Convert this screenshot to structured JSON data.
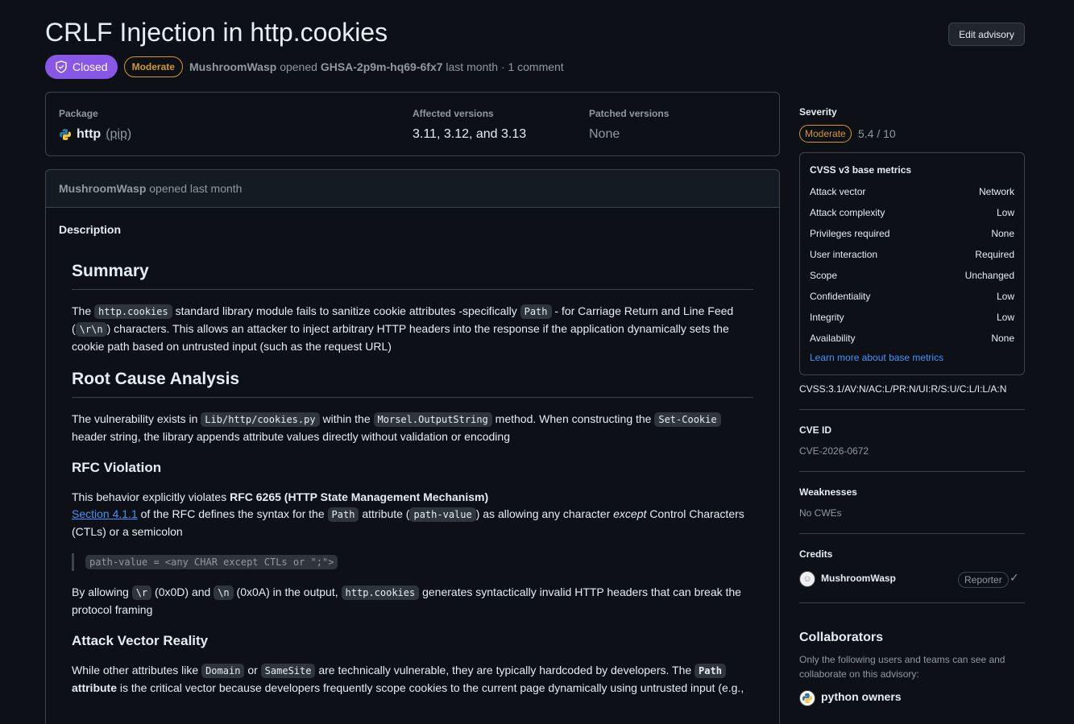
{
  "header": {
    "title": "CRLF Injection in http.cookies",
    "edit_label": "Edit advisory",
    "state": "Closed",
    "severity": "Moderate",
    "author": "MushroomWasp",
    "opened": "opened",
    "ghsa": "GHSA-2p9m-hq69-6fx7",
    "when": "last month",
    "comments": "· 1 comment"
  },
  "package": {
    "label": "Package",
    "name": "http",
    "ecosystem": "(pip)",
    "affected_label": "Affected versions",
    "affected": "3.11, 3.12, and 3.13",
    "patched_label": "Patched versions",
    "patched": "None"
  },
  "description": {
    "author": "MushroomWasp",
    "opened": "opened last month",
    "label": "Description",
    "summary_h": "Summary",
    "s1_a": "The ",
    "s1_code1": "http.cookies",
    "s1_b": " standard library module fails to sanitize cookie attributes -specifically ",
    "s1_code2": "Path",
    "s1_c": " - for Carriage Return and Line Feed (",
    "s1_code3": "\\r\\n",
    "s1_d": ") characters. This allows an attacker to inject arbitrary HTTP headers into the response if the application dynamically sets the cookie path based on untrusted input (such as the request URL)",
    "rca_h": "Root Cause Analysis",
    "r1_a": "The vulnerability exists in ",
    "r1_code1": "Lib/http/cookies.py",
    "r1_b": " within the ",
    "r1_code2": "Morsel.OutputString",
    "r1_c": " method. When constructing the ",
    "r1_code3": "Set-Cookie",
    "r1_d": " header string, the library appends attribute values directly without validation or encoding",
    "rfc_h": "RFC Violation",
    "v1_a": "This behavior explicitly violates ",
    "v1_b": "RFC 6265 (HTTP State Management Mechanism)",
    "v2_link": "Section 4.1.1",
    "v2_a": " of the RFC defines the syntax for the ",
    "v2_code1": "Path",
    "v2_b": " attribute (",
    "v2_code2": "path-value",
    "v2_c": ") as allowing any character ",
    "v2_em": "except",
    "v2_d": " Control Characters (CTLs) or a semicolon",
    "quote_code": "path-value = <any CHAR except CTLs or \";\">",
    "b1_a": "By allowing ",
    "b1_code1": "\\r",
    "b1_b": " (0x0D) and ",
    "b1_code2": "\\n",
    "b1_c": " (0x0A) in the output, ",
    "b1_code3": "http.cookies",
    "b1_d": " generates syntactically invalid HTTP headers that can break the protocol framing",
    "avr_h": "Attack Vector Reality",
    "w1_a": "While other attributes like ",
    "w1_code1": "Domain",
    "w1_b": " or ",
    "w1_code2": "SameSite",
    "w1_c": " are technically vulnerable, they are typically hardcoded by developers. The ",
    "w1_code3": "Path",
    "w1_strong": " attribute",
    "w1_d": " is the critical vector because developers frequently scope cookies to the current page dynamically using untrusted input (e.g.,"
  },
  "sidebar": {
    "severity_label": "Severity",
    "severity": "Moderate",
    "score": "5.4 / 10",
    "cvss_title": "CVSS v3 base metrics",
    "metrics": [
      {
        "k": "Attack vector",
        "v": "Network"
      },
      {
        "k": "Attack complexity",
        "v": "Low"
      },
      {
        "k": "Privileges required",
        "v": "None"
      },
      {
        "k": "User interaction",
        "v": "Required"
      },
      {
        "k": "Scope",
        "v": "Unchanged"
      },
      {
        "k": "Confidentiality",
        "v": "Low"
      },
      {
        "k": "Integrity",
        "v": "Low"
      },
      {
        "k": "Availability",
        "v": "None"
      }
    ],
    "learn_more": "Learn more about base metrics",
    "vector": "CVSS:3.1/AV:N/AC:L/PR:N/UI:R/S:U/C:L/I:L/A:N",
    "cve_label": "CVE ID",
    "cve": "CVE-2026-0672",
    "weak_label": "Weaknesses",
    "weak": "No CWEs",
    "credits_label": "Credits",
    "credit_user": "MushroomWasp",
    "credit_role": "Reporter",
    "collab_h": "Collaborators",
    "collab_desc": "Only the following users and teams can see and collaborate on this advisory:",
    "collab_team": "python owners"
  },
  "colors": {
    "accent": "#4493f8",
    "closed": "#8957e5",
    "moderate": "#d29922",
    "bg": "#0d1117"
  }
}
